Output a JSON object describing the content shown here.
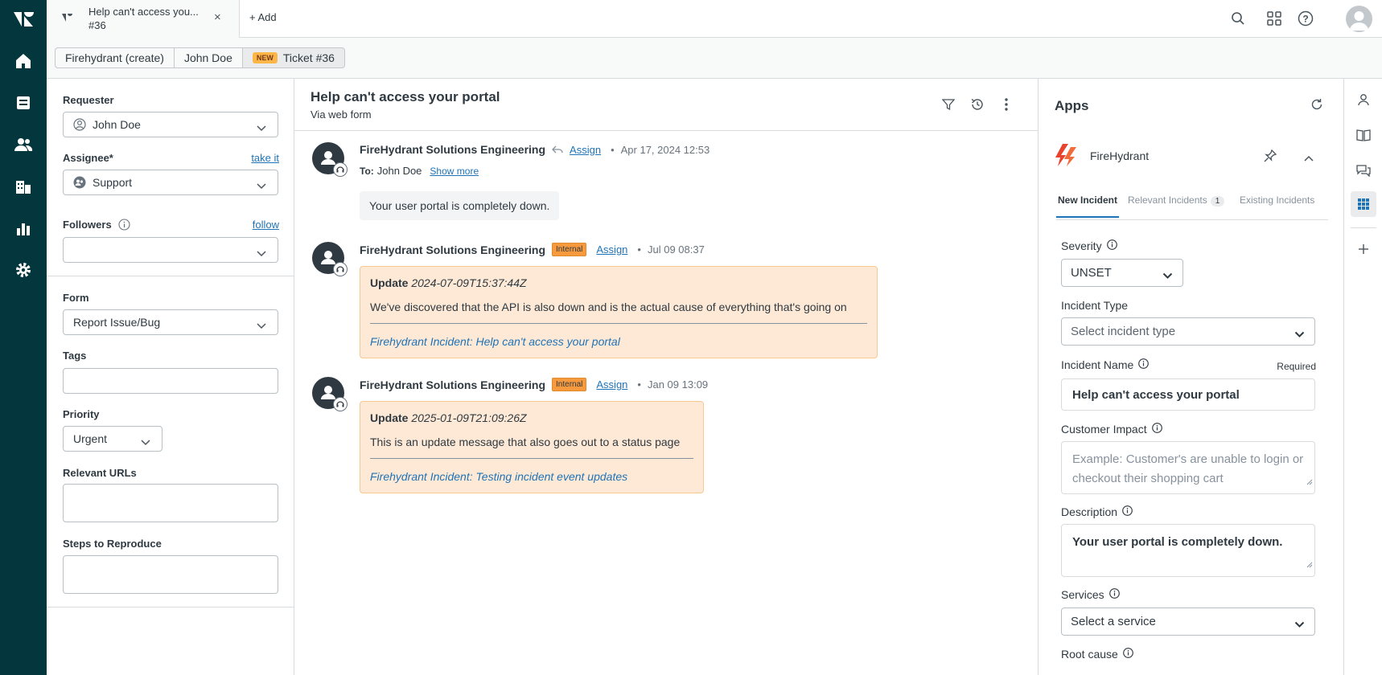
{
  "top_tab": {
    "title": "Help can't access you...",
    "subtitle": "#36",
    "close": "×"
  },
  "add_tab": "Add",
  "breadcrumbs": {
    "item1": "Firehydrant (create)",
    "item2": "John Doe",
    "badge": "NEW",
    "item3": "Ticket #36"
  },
  "left": {
    "requester_label": "Requester",
    "requester_value": "John Doe",
    "assignee_label": "Assignee*",
    "take_it": "take it",
    "assignee_value": "Support",
    "followers_label": "Followers",
    "follow": "follow",
    "form_label": "Form",
    "form_value": "Report Issue/Bug",
    "tags_label": "Tags",
    "priority_label": "Priority",
    "priority_value": "Urgent",
    "urls_label": "Relevant URLs",
    "steps_label": "Steps to Reproduce"
  },
  "ticket": {
    "title": "Help can't access your portal",
    "via": "Via web form"
  },
  "messages": [
    {
      "author": "FireHydrant Solutions Engineering",
      "assign": "Assign",
      "time": "Apr 17, 2024 12:53",
      "to_label": "To:",
      "to_value": "John Doe",
      "show_more": "Show more",
      "body": "Your user portal is completely down."
    },
    {
      "author": "FireHydrant Solutions Engineering",
      "badge": "Internal",
      "assign": "Assign",
      "time": "Jul 09 08:37",
      "update_label": "Update",
      "update_time": "2024-07-09T15:37:44Z",
      "body": "We've discovered that the API is also down and is the actual cause of everything that's going on",
      "incident_link": "Firehydrant Incident: Help can't access your portal"
    },
    {
      "author": "FireHydrant Solutions Engineering",
      "badge": "Internal",
      "assign": "Assign",
      "time": "Jan 09 13:09",
      "update_label": "Update",
      "update_time": "2025-01-09T21:09:26Z",
      "body": "This is an update message that also goes out to a status page",
      "incident_link": "Firehydrant Incident: Testing incident event updates"
    }
  ],
  "apps": {
    "title": "Apps",
    "app_name": "FireHydrant",
    "tabs": {
      "new": "New Incident",
      "relevant": "Relevant Incidents",
      "relevant_count": "1",
      "existing": "Existing Incidents"
    },
    "severity_label": "Severity",
    "severity_value": "UNSET",
    "incident_type_label": "Incident Type",
    "incident_type_placeholder": "Select incident type",
    "incident_name_label": "Incident Name",
    "required": "Required",
    "incident_name_value": "Help can't access your portal",
    "customer_impact_label": "Customer Impact",
    "customer_impact_placeholder": "Example: Customer's are unable to login or checkout their shopping cart",
    "description_label": "Description",
    "description_value": "Your user portal is completely down.",
    "services_label": "Services",
    "services_placeholder": "Select a service",
    "root_cause_label": "Root cause"
  },
  "colors": {
    "nav_bg": "#03363d",
    "link": "#1f73b7",
    "internal_bg": "#fde9d5",
    "internal_badge": "#f79a3e"
  }
}
